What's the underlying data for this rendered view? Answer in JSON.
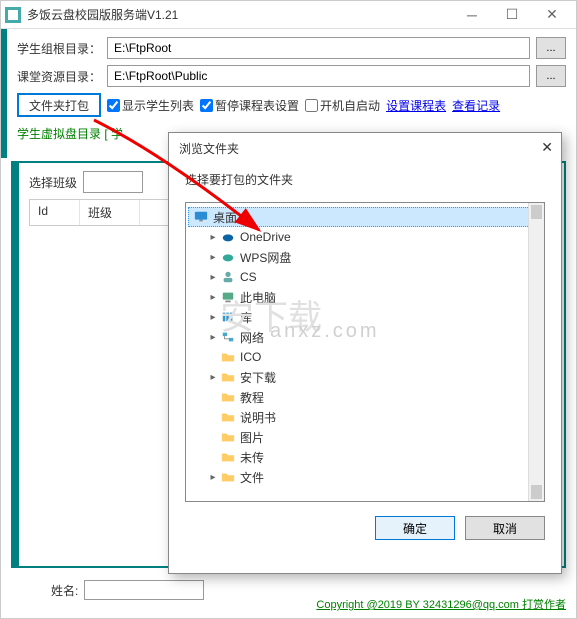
{
  "window": {
    "title": "多饭云盘校园版服务端V1.21"
  },
  "fields": {
    "root_label": "学生组根目录：",
    "root_value": "E:\\FtpRoot",
    "res_label": "课堂资源目录：",
    "res_value": "E:\\FtpRoot\\Public",
    "dots": "..."
  },
  "options": {
    "pack_btn": "文件夹打包",
    "show_list": "显示学生列表",
    "pause_sched": "暂停课程表设置",
    "autostart": "开机自启动",
    "set_sched": "设置课程表",
    "view_log": "查看记录"
  },
  "virtual_label": "学生虚拟盘目录    [ 学",
  "panel": {
    "select_class": "选择班级",
    "col_id": "Id",
    "col_class": "班级"
  },
  "name_label": "姓名:",
  "copyright": "Copyright @2019 BY 32431296@qq.com  打赏作者",
  "dialog": {
    "title": "浏览文件夹",
    "prompt": "选择要打包的文件夹",
    "ok": "确定",
    "cancel": "取消",
    "tree": {
      "desktop": "桌面",
      "onedrive": "OneDrive",
      "wps": "WPS网盘",
      "cs": "CS",
      "thispc": "此电脑",
      "lib": "库",
      "network": "网络",
      "ico": "ICO",
      "anxz": "安下载",
      "tutorial": "教程",
      "manual": "说明书",
      "pictures": "图片",
      "untrans": "未传",
      "files": "文件"
    }
  },
  "watermark": {
    "cn": "安下载",
    "en1": "",
    "en2": "anxz.com"
  }
}
